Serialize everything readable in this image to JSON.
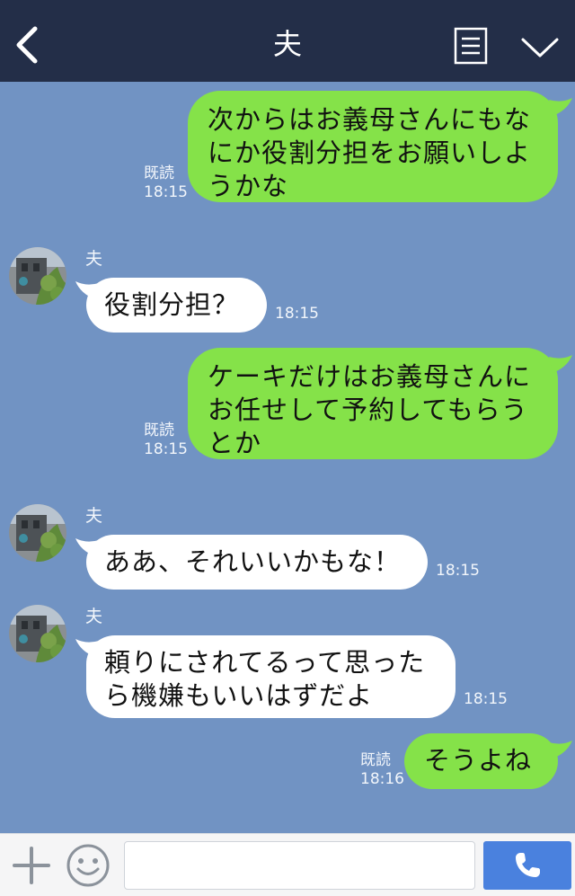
{
  "header": {
    "title": "夫",
    "back_icon": "chevron-left-icon",
    "menu_icon": "document-list-icon",
    "collapse_icon": "chevron-down-icon"
  },
  "messages": [
    {
      "from": "me",
      "lines": [
        "次からはお義母さんにもな",
        "にか役割分担をお願いしよ",
        "うかな"
      ],
      "read": "既読",
      "time": "18:15"
    },
    {
      "from": "them",
      "sender": "夫",
      "lines": [
        "役割分担？"
      ],
      "time": "18:15"
    },
    {
      "from": "me",
      "lines": [
        "ケーキだけはお義母さんに",
        "お任せして予約してもらう",
        "とか"
      ],
      "read": "既読",
      "time": "18:15"
    },
    {
      "from": "them",
      "sender": "夫",
      "lines": [
        "ああ、それいいかもな！"
      ],
      "time": "18:15"
    },
    {
      "from": "them",
      "sender": "夫",
      "lines": [
        "頼りにされてるって思った",
        "ら機嫌もいいはずだよ"
      ],
      "time": "18:15"
    },
    {
      "from": "me",
      "lines": [
        "そうよね"
      ],
      "read": "既読",
      "time": "18:16"
    }
  ],
  "input": {
    "placeholder": "",
    "value": ""
  },
  "colors": {
    "header_bg": "#232e48",
    "chat_bg": "#7193c3",
    "my_bubble": "#85e249",
    "their_bubble": "#ffffff",
    "send_button": "#4a81de"
  }
}
